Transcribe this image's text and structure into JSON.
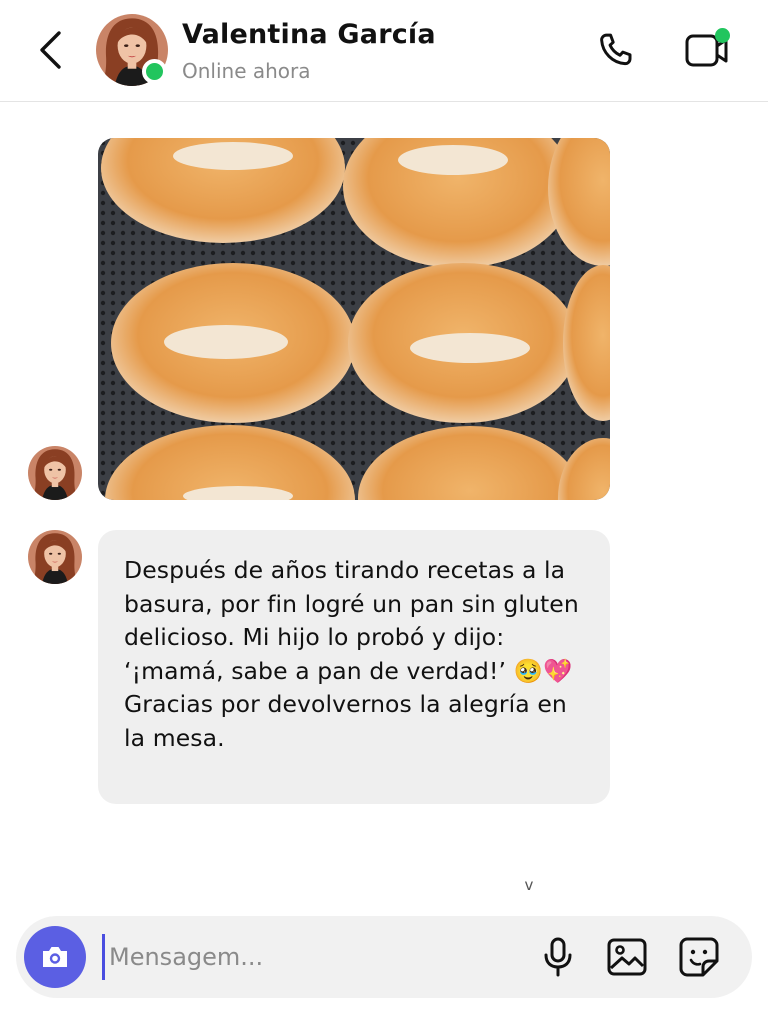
{
  "header": {
    "back_icon": "chevron-left-icon",
    "contact_name": "Valentina García",
    "status": "Online ahora",
    "online": true,
    "call_icon": "phone-icon",
    "video_icon": "video-camera-icon",
    "video_badge": true
  },
  "messages": [
    {
      "type": "image",
      "sender": "Valentina García",
      "description_icon": "bread-rolls-photo"
    },
    {
      "type": "text",
      "sender": "Valentina García",
      "text": "Después de años tirando recetas a la basura, por fin logré un pan sin gluten delicioso. Mi hijo lo probó y dijo: ‘¡mamá, sabe a pan de verdad!’ 🥹💖 Gracias por devolvernos la alegría en la mesa."
    }
  ],
  "scroll_indicator": "v",
  "composer": {
    "camera_icon": "camera-icon",
    "input_placeholder": "Mensagem...",
    "input_value": "",
    "mic_icon": "microphone-icon",
    "gallery_icon": "image-icon",
    "sticker_icon": "sticker-icon"
  },
  "colors": {
    "accent": "#5b5fe3",
    "online": "#22c55e",
    "bubble_bg": "#efefef",
    "status_text": "#8a8a8a"
  }
}
